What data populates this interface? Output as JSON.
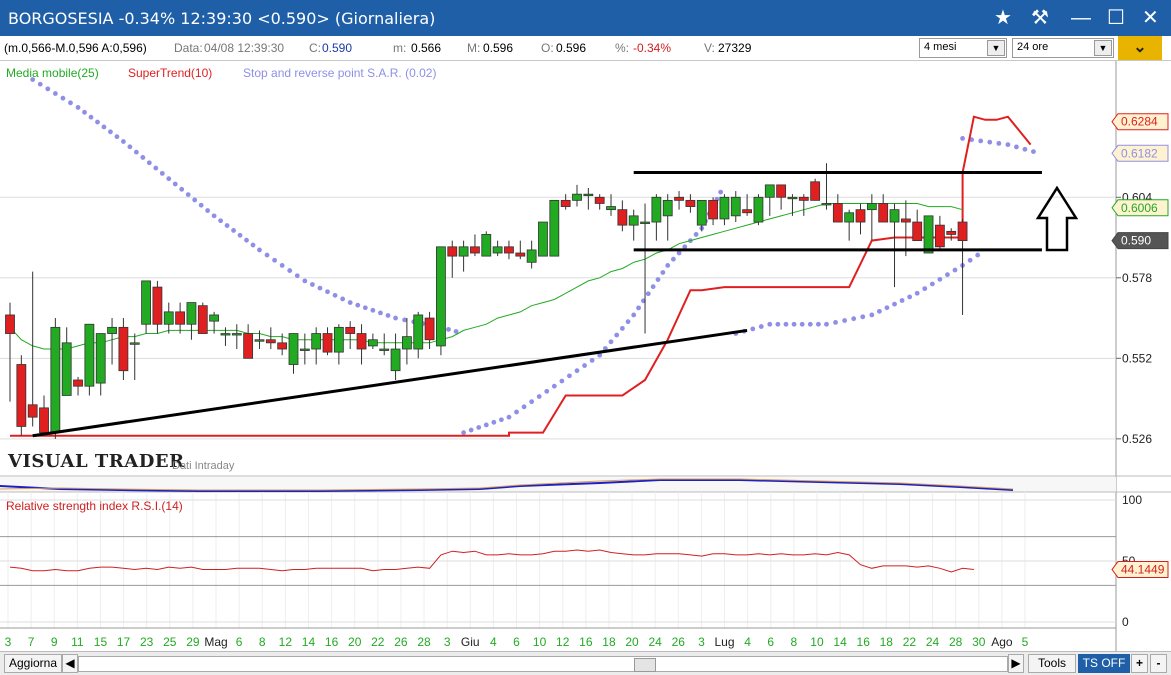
{
  "window": {
    "title": "BORGOSESIA -0.34% 12:39:30  <0.590> (Giornaliera)",
    "icons": [
      "star-icon",
      "hammer-icon",
      "minimize-icon",
      "maximize-icon",
      "close-icon"
    ]
  },
  "infobar": {
    "ohla": "(m.0,566-M.0,596 A:0,596)",
    "data_label": "Data:",
    "data_value": "04/08 12:39:30",
    "c_label": "C:",
    "c_value": "0.590",
    "m_label": "m:",
    "m_value": "0.566",
    "M_label": "M:",
    "M_value": "0.596",
    "o_label": "O:",
    "o_value": "0.596",
    "pct_label": "%:",
    "pct_value": "-0.34%",
    "v_label": "V:",
    "v_value": "27329",
    "period_select": "4 mesi",
    "interval_select": "24 ore"
  },
  "legend": {
    "ma": "Media mobile(25)",
    "supertrend": "SuperTrend(10)",
    "sar": "Stop and reverse point S.A.R. (0.02)"
  },
  "logo": {
    "name": "VISUAL TRADER",
    "sub": "Dati Intraday"
  },
  "rsi_label": "Relative strength index R.S.I.(14)",
  "bottombar": {
    "aggiorna": "Aggiorna",
    "tools": "Tools",
    "tsoff": "TS OFF",
    "plus": "+",
    "minus": "-"
  },
  "colors": {
    "up": "#22aa22",
    "down": "#e02020",
    "ma": "#22aa22",
    "supertrend": "#e02020",
    "sar": "#8f8fe8",
    "rsi": "#d02020",
    "titlebar": "#1e5fa8"
  },
  "chart_data": {
    "type": "candlestick",
    "price_axis": {
      "ticks": [
        "0.604",
        "0.578",
        "0.552",
        "0.526"
      ],
      "range": [
        0.514,
        0.648
      ]
    },
    "price_badges": [
      {
        "label": "0.6284",
        "value": 0.6284,
        "color": "#e02020"
      },
      {
        "label": "0.6182",
        "value": 0.6182,
        "color": "#8f8fe8"
      },
      {
        "label": "0.6006",
        "value": 0.6006,
        "color": "#22aa22"
      },
      {
        "label": "0.590",
        "value": 0.59,
        "color": "#444444"
      }
    ],
    "x_ticks": [
      "3",
      "7",
      "9",
      "11",
      "15",
      "17",
      "23",
      "25",
      "29",
      "Mag",
      "6",
      "8",
      "12",
      "14",
      "16",
      "20",
      "22",
      "26",
      "28",
      "3",
      "Giu",
      "4",
      "6",
      "10",
      "12",
      "16",
      "18",
      "20",
      "24",
      "26",
      "3",
      "Lug",
      "4",
      "6",
      "8",
      "10",
      "14",
      "16",
      "18",
      "22",
      "24",
      "28",
      "30",
      "Ago",
      "5"
    ],
    "candles": [
      [
        0.566,
        0.57,
        0.538,
        0.56
      ],
      [
        0.55,
        0.553,
        0.527,
        0.53
      ],
      [
        0.537,
        0.58,
        0.53,
        0.533
      ],
      [
        0.536,
        0.54,
        0.528,
        0.528
      ],
      [
        0.528,
        0.565,
        0.526,
        0.562
      ],
      [
        0.54,
        0.562,
        0.54,
        0.557
      ],
      [
        0.545,
        0.546,
        0.54,
        0.543
      ],
      [
        0.543,
        0.563,
        0.54,
        0.563
      ],
      [
        0.544,
        0.56,
        0.54,
        0.56
      ],
      [
        0.56,
        0.565,
        0.55,
        0.562
      ],
      [
        0.562,
        0.565,
        0.545,
        0.548
      ],
      [
        0.557,
        0.56,
        0.545,
        0.557
      ],
      [
        0.563,
        0.577,
        0.56,
        0.577
      ],
      [
        0.575,
        0.577,
        0.56,
        0.563
      ],
      [
        0.563,
        0.57,
        0.56,
        0.567
      ],
      [
        0.567,
        0.57,
        0.56,
        0.563
      ],
      [
        0.563,
        0.57,
        0.558,
        0.57
      ],
      [
        0.569,
        0.57,
        0.56,
        0.56
      ],
      [
        0.564,
        0.567,
        0.56,
        0.566
      ],
      [
        0.56,
        0.562,
        0.556,
        0.56
      ],
      [
        0.56,
        0.563,
        0.555,
        0.56
      ],
      [
        0.56,
        0.563,
        0.552,
        0.552
      ],
      [
        0.558,
        0.561,
        0.555,
        0.558
      ],
      [
        0.558,
        0.562,
        0.555,
        0.557
      ],
      [
        0.557,
        0.56,
        0.553,
        0.555
      ],
      [
        0.55,
        0.56,
        0.547,
        0.56
      ],
      [
        0.555,
        0.56,
        0.55,
        0.555
      ],
      [
        0.555,
        0.562,
        0.55,
        0.56
      ],
      [
        0.56,
        0.562,
        0.553,
        0.554
      ],
      [
        0.554,
        0.563,
        0.55,
        0.562
      ],
      [
        0.562,
        0.564,
        0.555,
        0.56
      ],
      [
        0.56,
        0.563,
        0.55,
        0.555
      ],
      [
        0.556,
        0.56,
        0.555,
        0.558
      ],
      [
        0.555,
        0.56,
        0.553,
        0.555
      ],
      [
        0.548,
        0.56,
        0.545,
        0.555
      ],
      [
        0.555,
        0.565,
        0.55,
        0.559
      ],
      [
        0.555,
        0.567,
        0.552,
        0.566
      ],
      [
        0.565,
        0.567,
        0.555,
        0.558
      ],
      [
        0.556,
        0.588,
        0.553,
        0.588
      ],
      [
        0.588,
        0.59,
        0.578,
        0.585
      ],
      [
        0.585,
        0.59,
        0.58,
        0.588
      ],
      [
        0.588,
        0.592,
        0.585,
        0.586
      ],
      [
        0.585,
        0.593,
        0.585,
        0.592
      ],
      [
        0.586,
        0.59,
        0.585,
        0.588
      ],
      [
        0.588,
        0.59,
        0.584,
        0.586
      ],
      [
        0.586,
        0.59,
        0.584,
        0.585
      ],
      [
        0.583,
        0.59,
        0.581,
        0.587
      ],
      [
        0.585,
        0.596,
        0.585,
        0.596
      ],
      [
        0.585,
        0.603,
        0.585,
        0.603
      ],
      [
        0.603,
        0.605,
        0.6,
        0.601
      ],
      [
        0.603,
        0.608,
        0.601,
        0.605
      ],
      [
        0.605,
        0.607,
        0.6,
        0.605
      ],
      [
        0.604,
        0.605,
        0.6,
        0.602
      ],
      [
        0.6,
        0.605,
        0.598,
        0.601
      ],
      [
        0.6,
        0.603,
        0.593,
        0.595
      ],
      [
        0.595,
        0.6,
        0.59,
        0.598
      ],
      [
        0.596,
        0.602,
        0.56,
        0.596
      ],
      [
        0.596,
        0.605,
        0.59,
        0.604
      ],
      [
        0.598,
        0.605,
        0.59,
        0.603
      ],
      [
        0.604,
        0.606,
        0.6,
        0.603
      ],
      [
        0.603,
        0.605,
        0.599,
        0.601
      ],
      [
        0.595,
        0.603,
        0.593,
        0.603
      ],
      [
        0.603,
        0.604,
        0.595,
        0.597
      ],
      [
        0.597,
        0.605,
        0.595,
        0.604
      ],
      [
        0.598,
        0.606,
        0.596,
        0.604
      ],
      [
        0.6,
        0.605,
        0.598,
        0.599
      ],
      [
        0.596,
        0.605,
        0.595,
        0.604
      ],
      [
        0.604,
        0.608,
        0.598,
        0.608
      ],
      [
        0.608,
        0.608,
        0.6,
        0.604
      ],
      [
        0.604,
        0.605,
        0.598,
        0.604
      ],
      [
        0.604,
        0.605,
        0.598,
        0.603
      ],
      [
        0.609,
        0.61,
        0.603,
        0.603
      ],
      [
        0.602,
        0.615,
        0.6,
        0.602
      ],
      [
        0.602,
        0.605,
        0.596,
        0.596
      ],
      [
        0.596,
        0.6,
        0.59,
        0.599
      ],
      [
        0.6,
        0.602,
        0.592,
        0.596
      ],
      [
        0.6,
        0.605,
        0.59,
        0.602
      ],
      [
        0.602,
        0.605,
        0.596,
        0.596
      ],
      [
        0.596,
        0.602,
        0.575,
        0.6
      ],
      [
        0.597,
        0.603,
        0.585,
        0.596
      ],
      [
        0.596,
        0.6,
        0.59,
        0.59
      ],
      [
        0.586,
        0.598,
        0.586,
        0.598
      ],
      [
        0.595,
        0.598,
        0.587,
        0.588
      ],
      [
        0.593,
        0.594,
        0.59,
        0.592
      ],
      [
        0.596,
        0.597,
        0.566,
        0.59
      ]
    ],
    "ma25": [
      0.562,
      0.558,
      0.556,
      0.555,
      0.555,
      0.555,
      0.556,
      0.557,
      0.557,
      0.558,
      0.559,
      0.559,
      0.56,
      0.56,
      0.561,
      0.561,
      0.561,
      0.561,
      0.561,
      0.561,
      0.561,
      0.56,
      0.56,
      0.559,
      0.559,
      0.558,
      0.558,
      0.558,
      0.558,
      0.558,
      0.558,
      0.558,
      0.557,
      0.557,
      0.557,
      0.557,
      0.557,
      0.557,
      0.558,
      0.559,
      0.561,
      0.562,
      0.563,
      0.565,
      0.566,
      0.567,
      0.569,
      0.57,
      0.571,
      0.573,
      0.575,
      0.577,
      0.578,
      0.58,
      0.581,
      0.583,
      0.584,
      0.586,
      0.587,
      0.589,
      0.59,
      0.591,
      0.592,
      0.593,
      0.594,
      0.595,
      0.596,
      0.597,
      0.598,
      0.599,
      0.6,
      0.601,
      0.602,
      0.602,
      0.602,
      0.602,
      0.602,
      0.602,
      0.602,
      0.602,
      0.602,
      0.601,
      0.601,
      0.601,
      0.6
    ],
    "supertrend": {
      "color": "#e02020",
      "points": [
        [
          0,
          0.527
        ],
        [
          33,
          0.527
        ],
        [
          44,
          0.527
        ],
        [
          44,
          0.528
        ],
        [
          47,
          0.528
        ],
        [
          49,
          0.54
        ],
        [
          54,
          0.54
        ],
        [
          56,
          0.545
        ],
        [
          58,
          0.558
        ],
        [
          60,
          0.574
        ],
        [
          61,
          0.574
        ],
        [
          63,
          0.575
        ],
        [
          65,
          0.575
        ],
        [
          70,
          0.575
        ],
        [
          72,
          0.575
        ],
        [
          74,
          0.575
        ],
        [
          76,
          0.59
        ],
        [
          78,
          0.591
        ],
        [
          80,
          0.591
        ],
        [
          84,
          0.591
        ],
        [
          84,
          0.612
        ],
        [
          85,
          0.63
        ],
        [
          86,
          0.629
        ],
        [
          87,
          0.629
        ],
        [
          88,
          0.63
        ],
        [
          90,
          0.621
        ]
      ]
    },
    "sar": {
      "color": "#8f8fe8",
      "segments": [
        [
          [
            2,
            0.642
          ],
          [
            6,
            0.633
          ],
          [
            10,
            0.622
          ],
          [
            14,
            0.61
          ],
          [
            18,
            0.598
          ],
          [
            22,
            0.587
          ],
          [
            26,
            0.577
          ],
          [
            30,
            0.57
          ],
          [
            34,
            0.565
          ],
          [
            38,
            0.562
          ],
          [
            40,
            0.56
          ]
        ],
        [
          [
            40,
            0.528
          ],
          [
            44,
            0.533
          ],
          [
            48,
            0.543
          ],
          [
            52,
            0.553
          ],
          [
            55,
            0.566
          ],
          [
            58,
            0.582
          ],
          [
            61,
            0.594
          ],
          [
            63,
            0.608
          ]
        ],
        [
          [
            64,
            0.56
          ],
          [
            67,
            0.563
          ],
          [
            72,
            0.563
          ],
          [
            76,
            0.566
          ],
          [
            80,
            0.573
          ],
          [
            84,
            0.582
          ],
          [
            86,
            0.587
          ]
        ],
        [
          [
            84,
            0.623
          ],
          [
            88,
            0.621
          ],
          [
            91,
            0.618
          ]
        ]
      ]
    },
    "trendlines": [
      {
        "name": "support-line",
        "points": [
          [
            2,
            0.527
          ],
          [
            65,
            0.561
          ]
        ]
      },
      {
        "name": "resistance-line",
        "points": [
          [
            55,
            0.612
          ],
          [
            91,
            0.612
          ]
        ]
      },
      {
        "name": "range-low-line",
        "points": [
          [
            55,
            0.587
          ],
          [
            91,
            0.587
          ]
        ]
      }
    ],
    "rsi": {
      "axis_ticks": [
        "100",
        "50",
        "0"
      ],
      "current_label": "44.1449",
      "values": [
        45,
        44,
        42,
        42,
        43,
        42,
        42,
        44,
        45,
        45,
        44,
        43,
        44,
        43,
        45,
        44,
        45,
        43,
        43,
        43,
        44,
        44,
        44,
        43,
        42,
        43,
        43,
        44,
        44,
        44,
        44,
        44,
        42,
        43,
        43,
        44,
        45,
        44,
        55,
        58,
        57,
        58,
        55,
        55,
        56,
        55,
        55,
        56,
        58,
        58,
        59,
        58,
        59,
        57,
        56,
        55,
        55,
        56,
        56,
        56,
        55,
        54,
        56,
        56,
        55,
        55,
        56,
        55,
        56,
        55,
        55,
        56,
        55,
        57,
        55,
        47,
        44,
        46,
        46,
        46,
        45,
        46,
        44,
        41,
        44,
        43
      ]
    }
  }
}
